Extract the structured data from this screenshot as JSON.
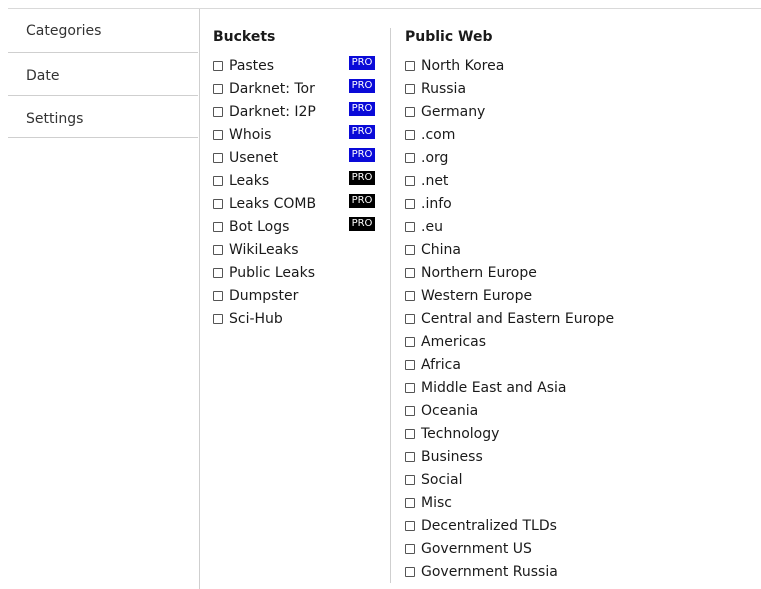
{
  "tabs": [
    {
      "label": "Categories"
    },
    {
      "label": "Date"
    },
    {
      "label": "Settings"
    }
  ],
  "buckets": {
    "title": "Buckets",
    "items": [
      {
        "label": "Pastes",
        "badge": "PRO",
        "badge_color": "#0a0ad8"
      },
      {
        "label": "Darknet: Tor",
        "badge": "PRO",
        "badge_color": "#0a0ad8"
      },
      {
        "label": "Darknet: I2P",
        "badge": "PRO",
        "badge_color": "#0a0ad8"
      },
      {
        "label": "Whois",
        "badge": "PRO",
        "badge_color": "#0a0ad8"
      },
      {
        "label": "Usenet",
        "badge": "PRO",
        "badge_color": "#0a0ad8"
      },
      {
        "label": "Leaks",
        "badge": "PRO",
        "badge_color": "#000000"
      },
      {
        "label": "Leaks COMB",
        "badge": "PRO",
        "badge_color": "#000000"
      },
      {
        "label": "Bot Logs",
        "badge": "PRO",
        "badge_color": "#000000"
      },
      {
        "label": "WikiLeaks"
      },
      {
        "label": "Public Leaks"
      },
      {
        "label": "Dumpster"
      },
      {
        "label": "Sci-Hub"
      }
    ]
  },
  "public_web": {
    "title": "Public Web",
    "items": [
      {
        "label": "North Korea"
      },
      {
        "label": "Russia"
      },
      {
        "label": "Germany"
      },
      {
        "label": ".com"
      },
      {
        "label": ".org"
      },
      {
        "label": ".net"
      },
      {
        "label": ".info"
      },
      {
        "label": ".eu"
      },
      {
        "label": "China"
      },
      {
        "label": "Northern Europe"
      },
      {
        "label": "Western Europe"
      },
      {
        "label": "Central and Eastern Europe"
      },
      {
        "label": "Americas"
      },
      {
        "label": "Africa"
      },
      {
        "label": "Middle East and Asia"
      },
      {
        "label": "Oceania"
      },
      {
        "label": "Technology"
      },
      {
        "label": "Business"
      },
      {
        "label": "Social"
      },
      {
        "label": "Misc"
      },
      {
        "label": "Decentralized TLDs"
      },
      {
        "label": "Government US"
      },
      {
        "label": "Government Russia"
      }
    ]
  }
}
